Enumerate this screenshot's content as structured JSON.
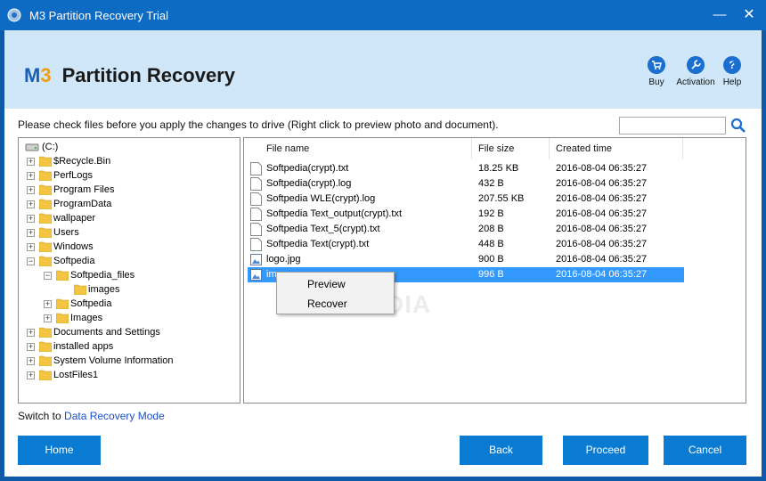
{
  "titlebar": {
    "title": "M3 Partition Recovery Trial",
    "minimize": "—",
    "close": "✕"
  },
  "header": {
    "logo_m": "M",
    "logo_3": "3",
    "logo_text": "Partition Recovery",
    "buy": {
      "label": "Buy",
      "icon": "cart-icon"
    },
    "activation": {
      "label": "Activation",
      "icon": "wrench-icon"
    },
    "help": {
      "label": "Help",
      "icon": "question-icon",
      "glyph": "?"
    }
  },
  "instruction": "Please check files before you apply the changes to drive (Right click to preview photo and document).",
  "search": {
    "value": ""
  },
  "tree": {
    "root": "(C:)",
    "items": [
      {
        "label": "$Recycle.Bin",
        "expander": "+"
      },
      {
        "label": "PerfLogs",
        "expander": "+"
      },
      {
        "label": "Program Files",
        "expander": "+"
      },
      {
        "label": "ProgramData",
        "expander": "+"
      },
      {
        "label": "wallpaper",
        "expander": "+"
      },
      {
        "label": "Users",
        "expander": "+"
      },
      {
        "label": "Windows",
        "expander": "+"
      },
      {
        "label": "Softpedia",
        "expander": "−"
      },
      {
        "label": "Softpedia_files",
        "expander": "−"
      },
      {
        "label": "images",
        "expander": ""
      },
      {
        "label": "Softpedia",
        "expander": "+"
      },
      {
        "label": "Images",
        "expander": "+"
      },
      {
        "label": "Documents and Settings",
        "expander": "+"
      },
      {
        "label": "installed apps",
        "expander": "+"
      },
      {
        "label": "System Volume Information",
        "expander": "+"
      },
      {
        "label": "LostFiles1",
        "expander": "+"
      }
    ]
  },
  "files": {
    "columns": {
      "name": "File name",
      "size": "File size",
      "time": "Created time"
    },
    "rows": [
      {
        "name": "Softpedia(crypt).txt",
        "size": "18.25 KB",
        "time": "2016-08-04 06:35:27",
        "type": "doc"
      },
      {
        "name": "Softpedia(crypt).log",
        "size": "432 B",
        "time": "2016-08-04 06:35:27",
        "type": "doc"
      },
      {
        "name": "Softpedia WLE(crypt).log",
        "size": "207.55 KB",
        "time": "2016-08-04 06:35:27",
        "type": "doc"
      },
      {
        "name": "Softpedia Text_output(crypt).txt",
        "size": "192 B",
        "time": "2016-08-04 06:35:27",
        "type": "doc"
      },
      {
        "name": "Softpedia Text_5(crypt).txt",
        "size": "208 B",
        "time": "2016-08-04 06:35:27",
        "type": "doc"
      },
      {
        "name": "Softpedia Text(crypt).txt",
        "size": "448 B",
        "time": "2016-08-04 06:35:27",
        "type": "doc"
      },
      {
        "name": "logo.jpg",
        "size": "900 B",
        "time": "2016-08-04 06:35:27",
        "type": "image"
      },
      {
        "name": "ima",
        "size": "996 B",
        "time": "2016-08-04 06:35:27",
        "type": "image"
      }
    ]
  },
  "context_menu": {
    "preview": "Preview",
    "recover": "Recover"
  },
  "switch": {
    "prefix": "Switch to",
    "link": "Data Recovery Mode"
  },
  "buttons": {
    "home": "Home",
    "back": "Back",
    "proceed": "Proceed",
    "cancel": "Cancel"
  },
  "watermark": "SOFTPEDIA",
  "colors": {
    "titlebar": "#0e6bc4",
    "header": "#cfe7f9",
    "button": "#0a7bd3",
    "selection": "#3399ff",
    "folder": "#f4c542"
  }
}
